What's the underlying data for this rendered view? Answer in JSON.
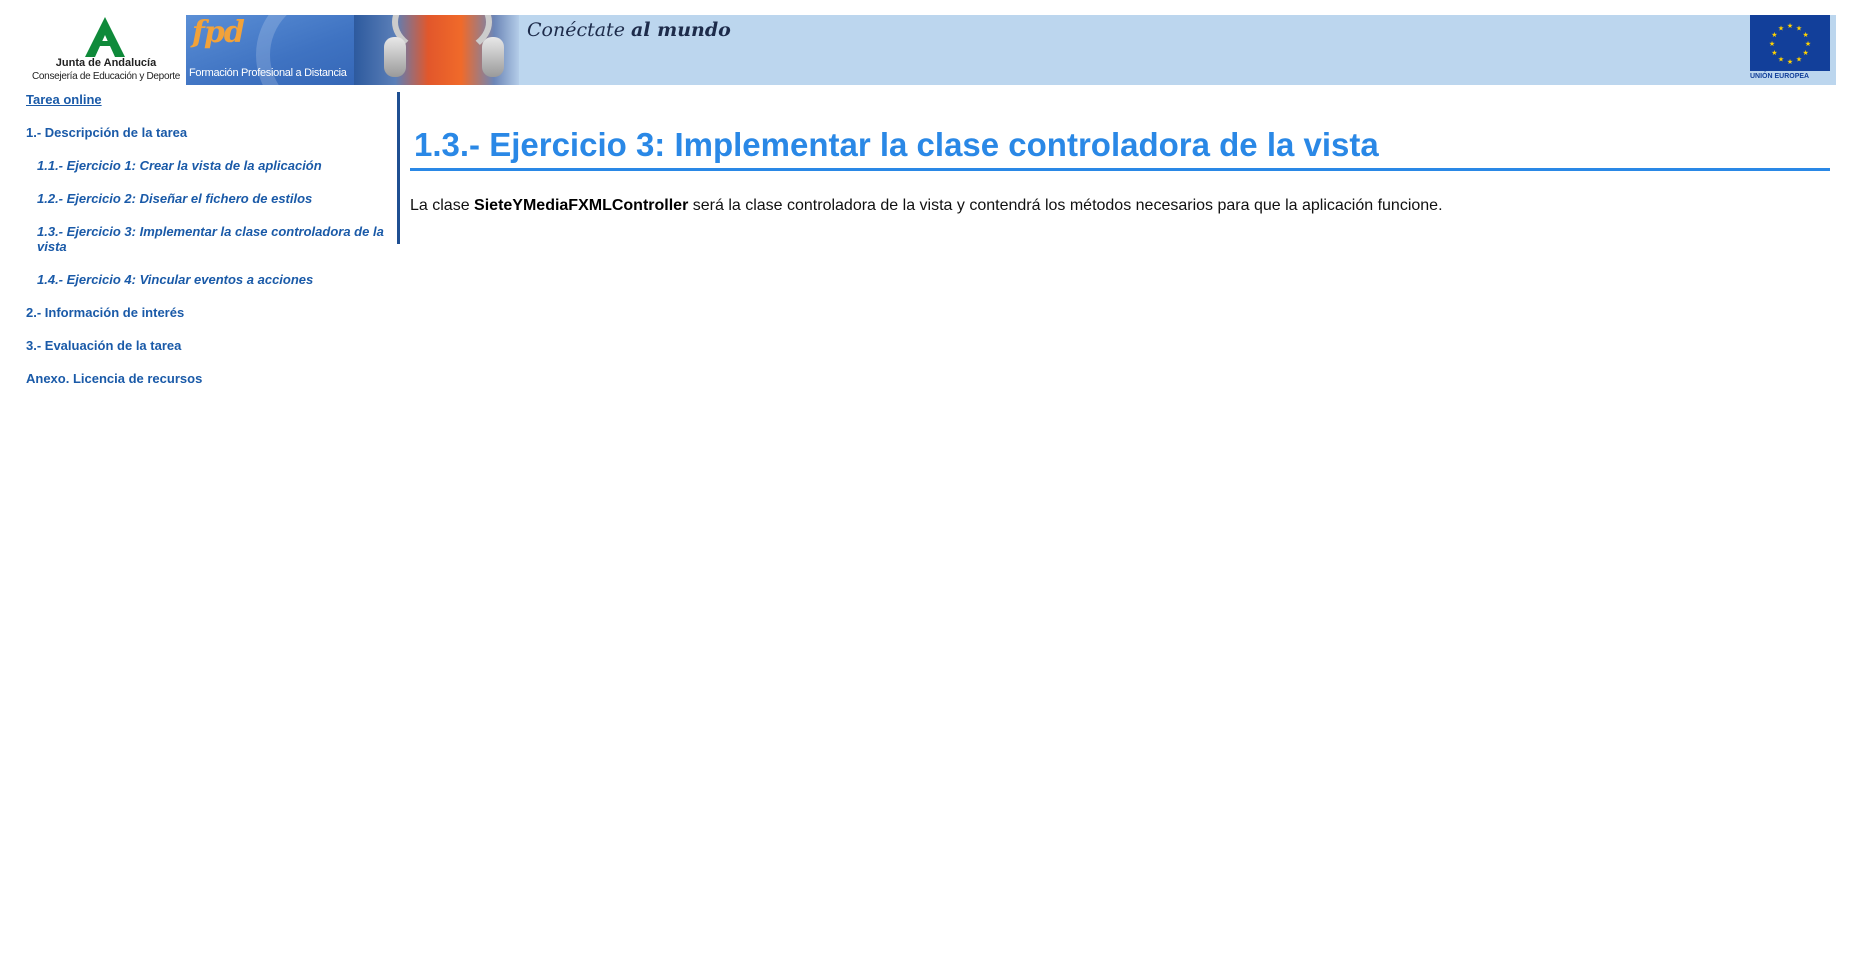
{
  "header": {
    "junta_name": "Junta de Andalucía",
    "junta_sub": "Consejería de Educación y Deporte",
    "fpd_logo": "fpd",
    "fpd_caption": "Formación Profesional a Distancia",
    "slogan_prefix": "Conéctate",
    "slogan_suffix": "al mundo",
    "eu_caption": "UNIÓN EUROPEA",
    "colors": {
      "banner": "#bcd6ee",
      "eu_blue": "#123f9a",
      "eu_star": "#ffd200",
      "junta_green": "#0f8a3a"
    },
    "icons": [
      "junta-andalucia-logo-icon",
      "eu-flag-icon"
    ]
  },
  "sidebar": {
    "top_link": "Tarea online",
    "items": [
      {
        "label": "1.- Descripción de la tarea",
        "level": 1
      },
      {
        "label": "1.1.- Ejercicio 1: Crear la vista de la aplicación",
        "level": 2
      },
      {
        "label": "1.2.- Ejercicio 2: Diseñar el fichero de estilos",
        "level": 2
      },
      {
        "label": "1.3.- Ejercicio 3: Implementar la clase controladora de la vista",
        "level": 2
      },
      {
        "label": "1.4.- Ejercicio 4: Vincular eventos a acciones",
        "level": 2
      },
      {
        "label": "2.- Información de interés",
        "level": 1
      },
      {
        "label": "3.- Evaluación de la tarea",
        "level": 1
      },
      {
        "label": "Anexo. Licencia de recursos",
        "level": 1
      }
    ],
    "link_color": "#1a5aa8"
  },
  "main": {
    "title": "1.3.- Ejercicio 3: Implementar la clase controladora de la vista",
    "title_color": "#2a88e6",
    "paragraph_before": "La clase ",
    "paragraph_bold": "SieteYMediaFXMLController",
    "paragraph_after": " será la clase controladora de la vista y contendrá los métodos necesarios para que la aplicación funcione."
  }
}
